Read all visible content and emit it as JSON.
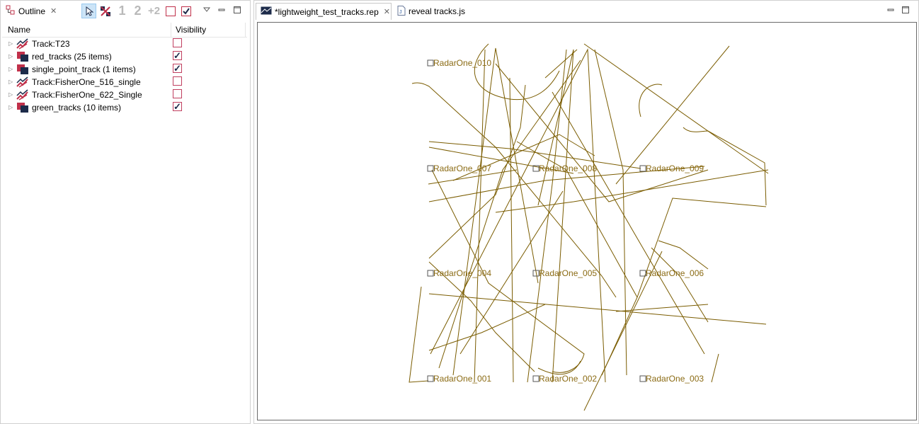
{
  "outline": {
    "tab_title": "Outline",
    "toolbar": {
      "icons": [
        "select-pointer-icon",
        "hide-tracks-icon",
        "one-icon",
        "two-icon",
        "plus-two-icon",
        "uncheck-all-icon",
        "check-all-icon",
        "view-menu-icon",
        "minimize-icon",
        "maximize-icon"
      ],
      "num_1": "1",
      "num_2": "2",
      "num_plus2": "+2"
    },
    "columns": {
      "name": "Name",
      "visibility": "Visibility"
    },
    "rows": [
      {
        "label": "Track:T23",
        "visible": false,
        "icon": "track-icon"
      },
      {
        "label": "red_tracks (25 items)",
        "visible": true,
        "icon": "layer-icon"
      },
      {
        "label": "single_point_track (1 items)",
        "visible": true,
        "icon": "layer-icon"
      },
      {
        "label": "Track:FisherOne_516_single",
        "visible": false,
        "icon": "track-icon"
      },
      {
        "label": "Track:FisherOne_622_Single",
        "visible": false,
        "icon": "track-icon"
      },
      {
        "label": "green_tracks (10 items)",
        "visible": true,
        "icon": "layer-icon"
      }
    ]
  },
  "editor": {
    "tabs": [
      {
        "label": "*lightweight_test_tracks.rep",
        "active": true,
        "icon": "rep-file-icon"
      },
      {
        "label": "reveal tracks.js",
        "active": false,
        "icon": "js-file-icon"
      }
    ]
  },
  "plot": {
    "track_color": "#7a5c00",
    "label_color": "#8b6b14",
    "sensors": [
      {
        "label": "RadarOne_010"
      },
      {
        "label": "RadarOne_007"
      },
      {
        "label": "RadarOne_008"
      },
      {
        "label": "RadarOne_009"
      },
      {
        "label": "RadarOne_004"
      },
      {
        "label": "RadarOne_005"
      },
      {
        "label": "RadarOne_006"
      },
      {
        "label": "RadarOne_001"
      },
      {
        "label": "RadarOne_002"
      },
      {
        "label": "RadarOne_003"
      }
    ]
  }
}
